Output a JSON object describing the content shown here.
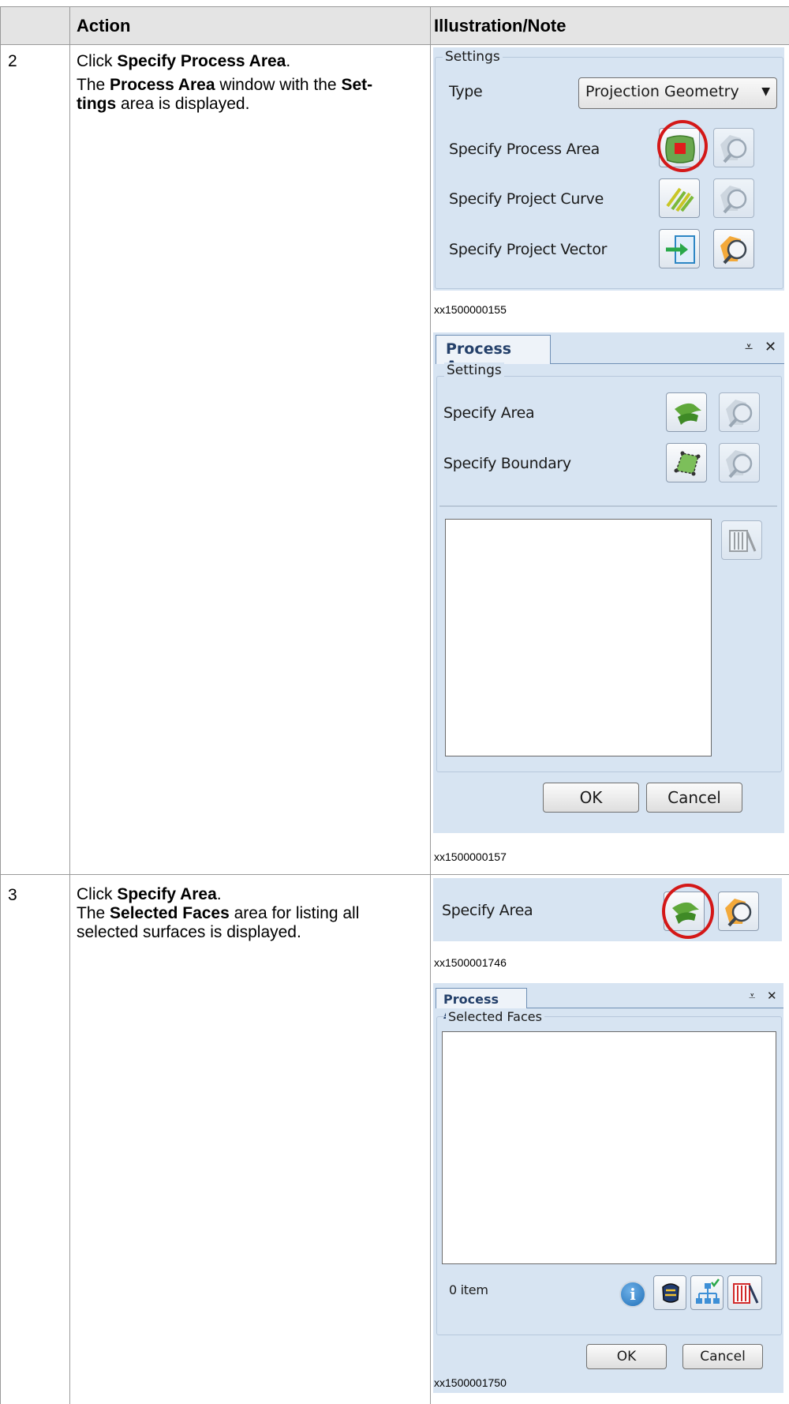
{
  "table": {
    "header": {
      "action": "Action",
      "illustration": "Illustration/Note"
    },
    "rows": [
      {
        "step": "2",
        "action_line1_pre": "Click ",
        "action_line1_bold": "Specify Process Area",
        "action_line1_post": ".",
        "action_line2_pre": "The ",
        "action_line2_bold1": "Process Area",
        "action_line2_mid": " window with the ",
        "action_line2_bold2": "Set-",
        "action_line3_bold": "tings",
        "action_line3_post": " area is displayed."
      },
      {
        "step": "3",
        "action_line1_pre": "Click ",
        "action_line1_bold": "Specify Area",
        "action_line1_post": ".",
        "action_line2_pre": "The ",
        "action_line2_bold": "Selected Faces",
        "action_line2_post": " area for listing all",
        "action_line3": "selected surfaces is displayed."
      }
    ]
  },
  "figure1": {
    "group_title": "Settings",
    "type_label": "Type",
    "type_value": "Projection Geometry",
    "rows": [
      {
        "label": "Specify Process Area",
        "icon": "process-area-icon"
      },
      {
        "label": "Specify Project Curve",
        "icon": "project-curve-icon"
      },
      {
        "label": "Specify Project Vector",
        "icon": "project-vector-icon"
      }
    ],
    "caption": "xx1500000155"
  },
  "figure2": {
    "tab": "Process Area",
    "pin_symbol": "⩡",
    "close_symbol": "✕",
    "group_title": "Settings",
    "rows": [
      {
        "label": "Specify Area",
        "icon": "surface-icon"
      },
      {
        "label": "Specify Boundary",
        "icon": "boundary-icon"
      }
    ],
    "ok": "OK",
    "cancel": "Cancel",
    "caption": "xx1500000157"
  },
  "figure3": {
    "label": "Specify Area",
    "caption": "xx1500001746"
  },
  "figure4": {
    "tab": "Process Area",
    "pin_symbol": "⩡",
    "close_symbol": "✕",
    "group_title": "Selected Faces",
    "count": "0 item",
    "ok": "OK",
    "cancel": "Cancel",
    "caption": "xx1500001750"
  },
  "colors": {
    "panel": "#d7e4f2",
    "highlight_ring": "#d41818",
    "surface_green": "#5fa83a"
  }
}
